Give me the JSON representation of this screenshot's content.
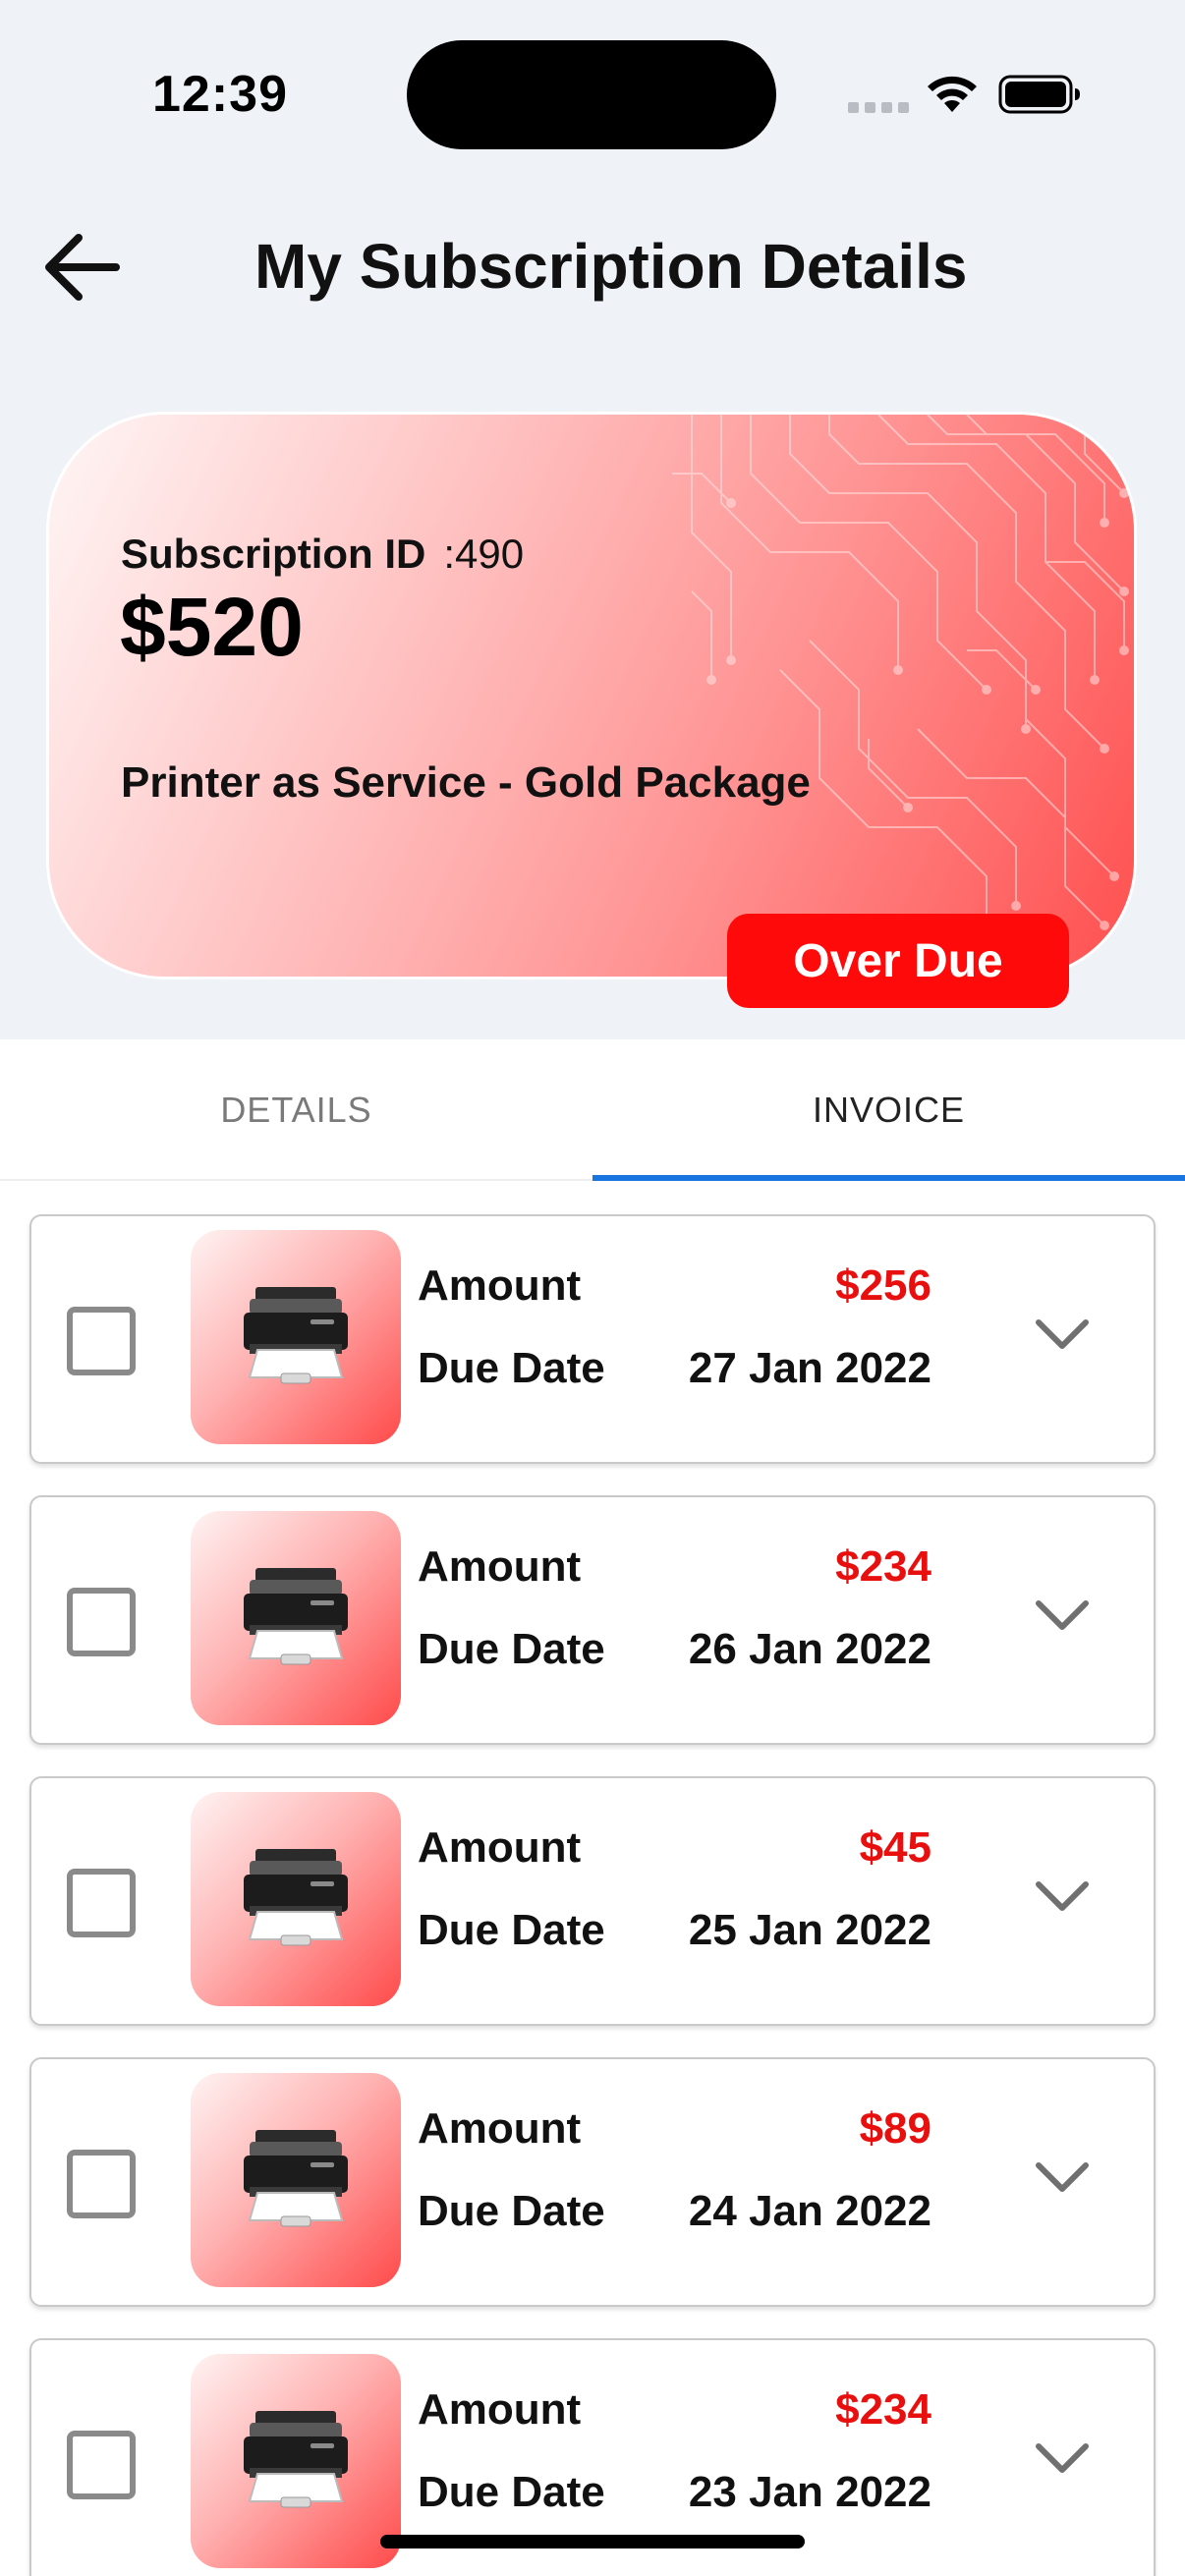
{
  "status_bar": {
    "time": "12:39"
  },
  "header": {
    "title": "My Subscription Details"
  },
  "subscription": {
    "id_label": "Subscription ID",
    "id_value": ":490",
    "amount": "$520",
    "package": "Printer as Service - Gold Package",
    "status": "Over Due"
  },
  "tabs": [
    {
      "label": "DETAILS",
      "selected": false
    },
    {
      "label": "INVOICE",
      "selected": true
    }
  ],
  "invoice_labels": {
    "amount": "Amount",
    "due_date": "Due Date"
  },
  "invoices": [
    {
      "amount": "$256",
      "due_date": "27 Jan 2022"
    },
    {
      "amount": "$234",
      "due_date": "26 Jan 2022"
    },
    {
      "amount": "$45",
      "due_date": "25 Jan 2022"
    },
    {
      "amount": "$89",
      "due_date": "24 Jan 2022"
    },
    {
      "amount": "$234",
      "due_date": "23 Jan 2022"
    }
  ],
  "icons": {
    "back": "arrow-left-icon",
    "expand": "chevron-down-icon",
    "product": "printer-icon"
  },
  "colors": {
    "accent_red": "#e8100f",
    "status_red": "#ff0a0a",
    "tab_indicator": "#1976e0",
    "background": "#eff2f7"
  }
}
